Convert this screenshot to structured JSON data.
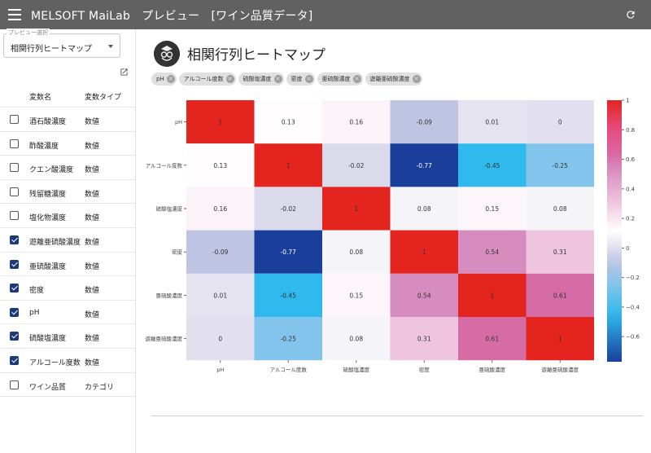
{
  "app": {
    "title": "MELSOFT MaiLab　プレビュー　[ワイン品質データ]"
  },
  "sidebar": {
    "select_label": "プレビュー選択",
    "select_value": "相関行列ヒートマップ",
    "headers": {
      "name": "変数名",
      "type": "変数タイプ"
    },
    "variables": [
      {
        "name": "酒石酸濃度",
        "type": "数値",
        "checked": false
      },
      {
        "name": "酢酸濃度",
        "type": "数値",
        "checked": false
      },
      {
        "name": "クエン酸濃度",
        "type": "数値",
        "checked": false
      },
      {
        "name": "残留糖濃度",
        "type": "数値",
        "checked": false
      },
      {
        "name": "塩化物濃度",
        "type": "数値",
        "checked": false
      },
      {
        "name": "遊離亜硫酸濃度",
        "type": "数値",
        "checked": true
      },
      {
        "name": "亜硫酸濃度",
        "type": "数値",
        "checked": true
      },
      {
        "name": "密度",
        "type": "数値",
        "checked": true
      },
      {
        "name": "pH",
        "type": "数値",
        "checked": true
      },
      {
        "name": "硫酸塩濃度",
        "type": "数値",
        "checked": true
      },
      {
        "name": "アルコール度数",
        "type": "数値",
        "checked": true
      },
      {
        "name": "ワイン品質",
        "type": "カテゴリ",
        "checked": false
      }
    ]
  },
  "main": {
    "title": "相関行列ヒートマップ",
    "chips": [
      "pH",
      "アルコール度数",
      "硫酸塩濃度",
      "密度",
      "亜硫酸濃度",
      "遊離亜硫酸濃度"
    ]
  },
  "chart_data": {
    "type": "heatmap",
    "rows": [
      "pH",
      "アルコール度数",
      "硫酸塩濃度",
      "密度",
      "亜硫酸濃度",
      "遊離亜硫酸濃度"
    ],
    "columns": [
      "pH",
      "アルコール度数",
      "硫酸塩濃度",
      "密度",
      "亜硫酸濃度",
      "遊離亜硫酸濃度"
    ],
    "values": [
      [
        1,
        0.13,
        0.16,
        -0.09,
        0.01,
        0
      ],
      [
        0.13,
        1,
        -0.02,
        -0.77,
        -0.45,
        -0.25
      ],
      [
        0.16,
        -0.02,
        1,
        0.08,
        0.15,
        0.08
      ],
      [
        -0.09,
        -0.77,
        0.08,
        1,
        0.54,
        0.31
      ],
      [
        0.01,
        -0.45,
        0.15,
        0.54,
        1,
        0.61
      ],
      [
        0,
        -0.25,
        0.08,
        0.31,
        0.61,
        1
      ]
    ],
    "colorbar": {
      "range": [
        -0.77,
        1
      ],
      "ticks": [
        1,
        0.8,
        0.6,
        0.4,
        0.2,
        0,
        -0.2,
        -0.4,
        -0.6
      ]
    },
    "colors": {
      "low": "#1a3f9a",
      "mid": "#ffffff",
      "high": "#e3241f"
    }
  }
}
